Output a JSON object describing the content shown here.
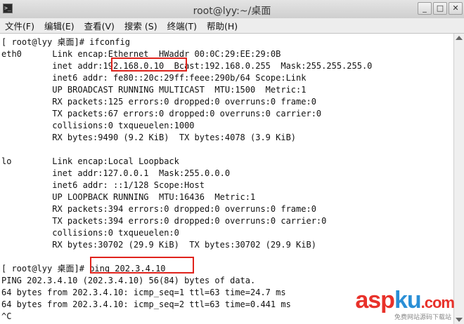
{
  "window": {
    "title": "root@lyy:~/桌面",
    "buttons": [
      "_",
      "□",
      "✕"
    ]
  },
  "menu": [
    "文件(F)",
    "编辑(E)",
    "查看(V)",
    "搜索 (S)",
    "终端(T)",
    "帮助(H)"
  ],
  "terminal": {
    "lines": [
      "[ root@lyy 桌面]# ifconfig",
      "eth0      Link encap:Ethernet  HWaddr 00:0C:29:EE:29:0B",
      "          inet addr:192.168.0.10  Bcast:192.168.0.255  Mask:255.255.255.0",
      "          inet6 addr: fe80::20c:29ff:feee:290b/64 Scope:Link",
      "          UP BROADCAST RUNNING MULTICAST  MTU:1500  Metric:1",
      "          RX packets:125 errors:0 dropped:0 overruns:0 frame:0",
      "          TX packets:67 errors:0 dropped:0 overruns:0 carrier:0",
      "          collisions:0 txqueuelen:1000",
      "          RX bytes:9490 (9.2 KiB)  TX bytes:4078 (3.9 KiB)",
      "",
      "lo        Link encap:Local Loopback",
      "          inet addr:127.0.0.1  Mask:255.0.0.0",
      "          inet6 addr: ::1/128 Scope:Host",
      "          UP LOOPBACK RUNNING  MTU:16436  Metric:1",
      "          RX packets:394 errors:0 dropped:0 overruns:0 frame:0",
      "          TX packets:394 errors:0 dropped:0 overruns:0 carrier:0",
      "          collisions:0 txqueuelen:0",
      "          RX bytes:30702 (29.9 KiB)  TX bytes:30702 (29.9 KiB)",
      "",
      "[ root@lyy 桌面]# ping 202.3.4.10",
      "PING 202.3.4.10 (202.3.4.10) 56(84) bytes of data.",
      "64 bytes from 202.3.4.10: icmp_seq=1 ttl=63 time=24.7 ms",
      "64 bytes from 202.3.4.10: icmp_seq=2 ttl=63 time=0.441 ms",
      "^C"
    ]
  },
  "watermark": {
    "text_a": "asp",
    "text_b": "ku",
    "text_c": ".com",
    "subtitle": "免费网站源码下载站",
    "color_main": "#e8312a",
    "color_accent": "#2a8fd6"
  },
  "colors": {
    "highlight": "#e0231c"
  }
}
